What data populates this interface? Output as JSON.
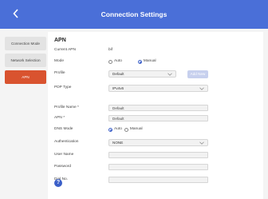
{
  "header": {
    "title": "Connection Settings"
  },
  "sidebar": {
    "items": [
      {
        "label": "Connection Mode",
        "active": false
      },
      {
        "label": "Network Selection",
        "active": false
      },
      {
        "label": "APN",
        "active": true
      }
    ]
  },
  "apn": {
    "section_title": "APN",
    "current_apn_label": "Current APN",
    "current_apn_value": "bif",
    "mode_label": "Mode",
    "mode_auto": "Auto",
    "mode_manual": "Manual",
    "profile_label": "Profile",
    "profile_value": "Default",
    "add_new_label": "Add New",
    "pdp_type_label": "PDP Type",
    "pdp_type_value": "IPv4v6",
    "profile_name_label": "Profile Name *",
    "profile_name_value": "Default",
    "apn_label": "APN *",
    "apn_value": "Default",
    "dns_mode_label": "DNS Mode",
    "dns_auto": "Auto",
    "dns_manual": "Manual",
    "auth_label": "Authentication",
    "auth_value": "NONE",
    "user_name_label": "User Name",
    "user_name_value": "",
    "password_label": "Password",
    "password_value": "",
    "dial_no_label": "Dial No.",
    "dial_no_value": ""
  },
  "help": {
    "glyph": "?"
  },
  "colors": {
    "accent": "#4a6fd8",
    "active_tab": "#d9532f",
    "radio_selected": "#3b5fc8"
  }
}
